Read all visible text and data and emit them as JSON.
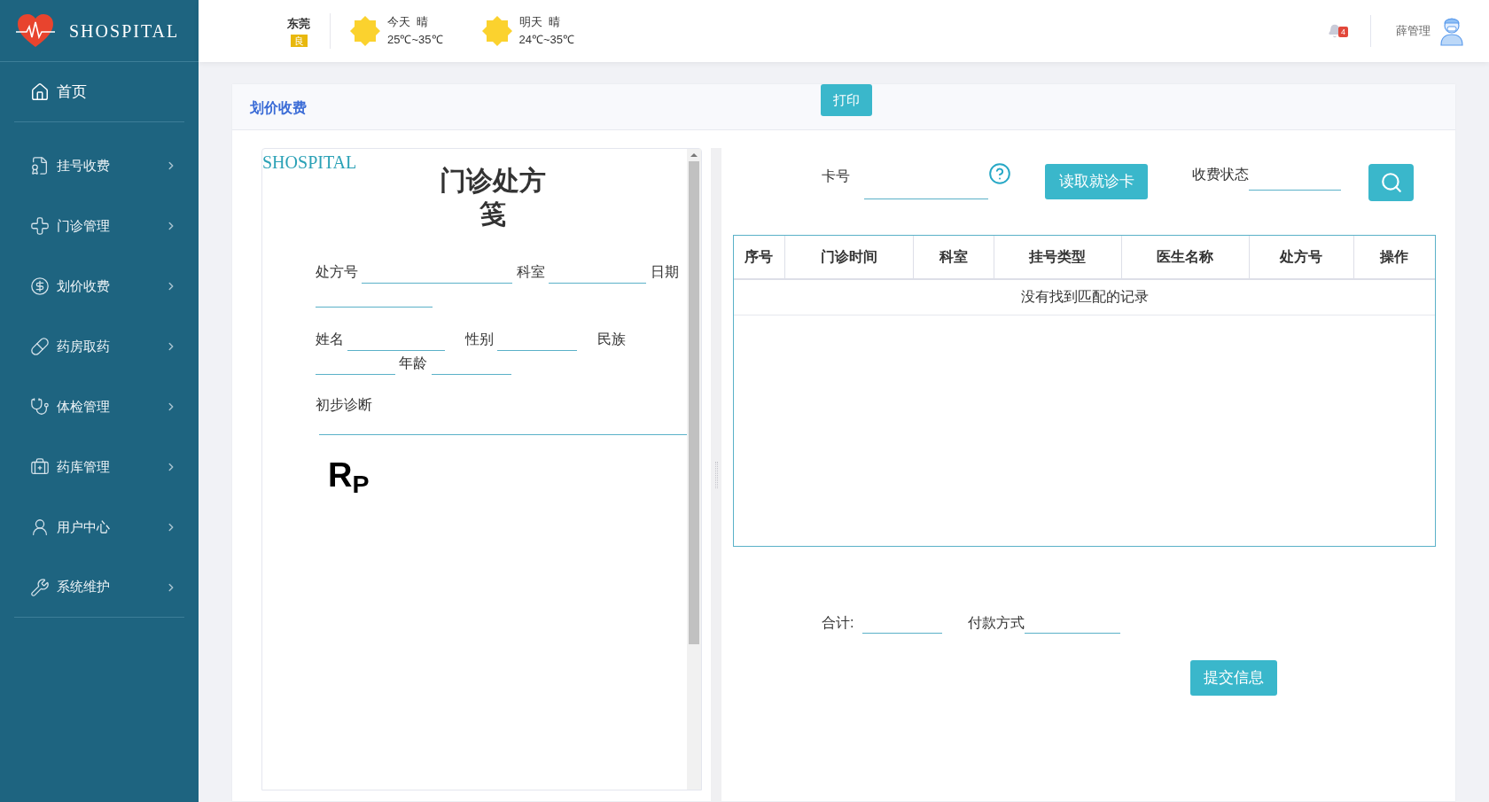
{
  "sidebar": {
    "brand": "SHOSPITAL",
    "items": [
      {
        "label": "首页",
        "kind": "home"
      },
      {
        "label": "挂号收费",
        "kind": "menu"
      },
      {
        "label": "门诊管理",
        "kind": "menu"
      },
      {
        "label": "划价收费",
        "kind": "menu"
      },
      {
        "label": "药房取药",
        "kind": "menu"
      },
      {
        "label": "体检管理",
        "kind": "menu"
      },
      {
        "label": "药库管理",
        "kind": "menu"
      },
      {
        "label": "用户中心",
        "kind": "menu"
      },
      {
        "label": "系统维护",
        "kind": "menu"
      }
    ]
  },
  "header": {
    "city": "东莞",
    "air_quality": "良",
    "weather": [
      {
        "day": "今天",
        "condition": "晴",
        "range": "25℃~35℃"
      },
      {
        "day": "明天",
        "condition": "晴",
        "range": "24℃~35℃"
      }
    ],
    "notifications": "4",
    "user": "薛管理"
  },
  "card": {
    "title": "划价收费",
    "print_button": "打印"
  },
  "prescription": {
    "brand": "SHOSPITAL",
    "title": "门诊处方笺",
    "row_1": [
      "处方号",
      "科室",
      "日期"
    ],
    "row_2": [
      "姓名",
      "性别",
      "民族",
      "年龄"
    ],
    "diagnosis": "初步诊断",
    "rp": "R$_{P}$"
  },
  "search": {
    "card_label": "卡号",
    "read_button": "读取就诊卡",
    "status_label": "收费状态"
  },
  "table": {
    "columns": [
      "序号",
      "门诊时间",
      "科室",
      "挂号类型",
      "医生名称",
      "处方号",
      "操作"
    ],
    "empty_message": "没有找到匹配的记录"
  },
  "summary": {
    "total_label": "合计:",
    "payment_label": "付款方式",
    "submit_button": "提交信息"
  }
}
